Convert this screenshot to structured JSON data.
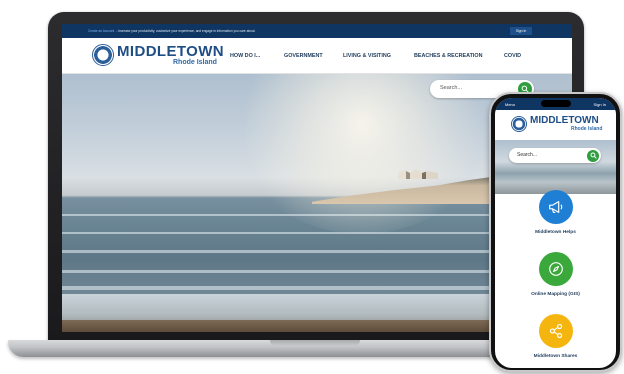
{
  "announcement": {
    "link_text": "Create an Account",
    "text": "- Increase your productivity, customize your experience, and engage in information you care about.",
    "sign_in": "Sign In"
  },
  "site": {
    "title": "MIDDLETOWN",
    "subtitle": "Rhode Island"
  },
  "nav": {
    "items": [
      {
        "label": "HOW DO I..."
      },
      {
        "label": "GOVERNMENT"
      },
      {
        "label": "LIVING & VISITING"
      },
      {
        "label": "BEACHES & RECREATION"
      },
      {
        "label": "COVID"
      }
    ]
  },
  "search": {
    "placeholder": "Search..."
  },
  "mobile": {
    "menu_label": "Menu",
    "sign_in": "Sign In",
    "title": "MIDDLETOWN",
    "subtitle": "Rhode Island",
    "search_placeholder": "Search...",
    "quick_links": [
      {
        "label": "Middletown Helps",
        "icon": "megaphone-icon",
        "color": "#1f7fd4"
      },
      {
        "label": "Online Mapping (GIS)",
        "icon": "compass-icon",
        "color": "#3aa83a"
      },
      {
        "label": "Middletown Shares",
        "icon": "share-icon",
        "color": "#f5b50f"
      }
    ]
  },
  "colors": {
    "brand_navy": "#0f3663",
    "logo_blue": "#1f4e85",
    "search_green": "#2e9e3e"
  }
}
